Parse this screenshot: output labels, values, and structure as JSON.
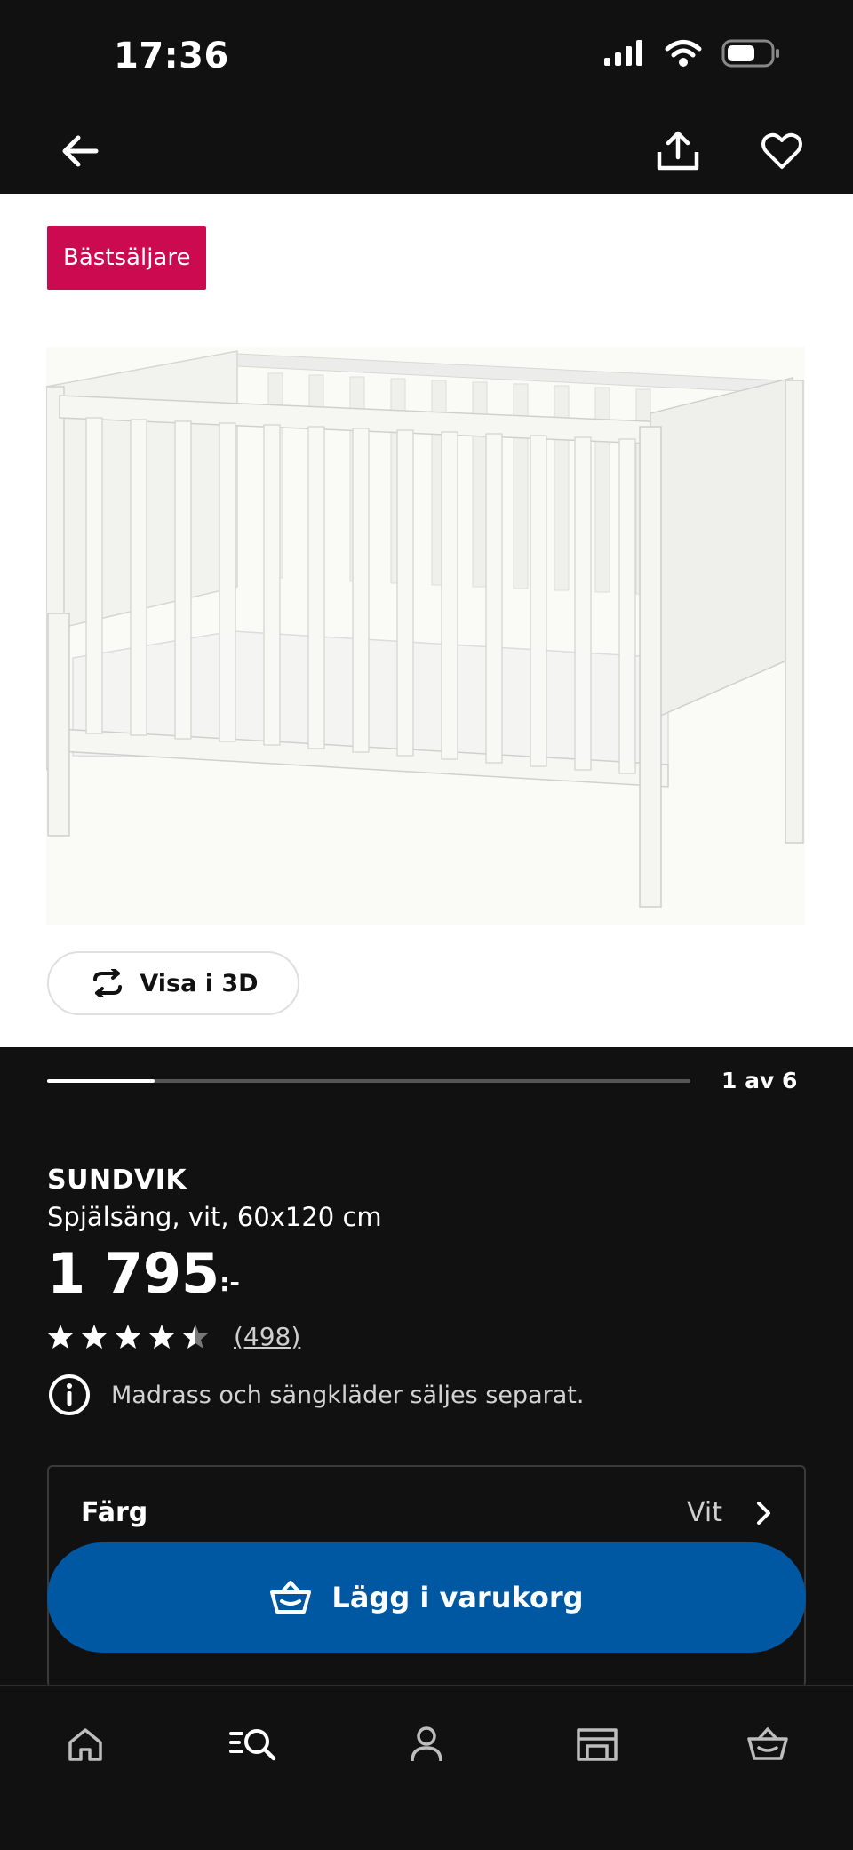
{
  "status_bar": {
    "time": "17:36"
  },
  "nav": {
    "back_icon": "arrow-left-icon",
    "share_icon": "share-icon",
    "favorite_icon": "heart-icon"
  },
  "product": {
    "badge": "Bästsäljare",
    "view_3d_label": "Visa i 3D",
    "image_position": "1 av 6",
    "image_progress_fraction": 0.1667,
    "brand": "SUNDVIK",
    "description": "Spjälsäng, vit, 60x120 cm",
    "price_main": "1 795",
    "price_suffix": ":-",
    "rating_stars": 4.5,
    "review_count": "(498)",
    "notice": "Madrass och sängkläder säljes separat."
  },
  "color": {
    "label": "Färg",
    "value": "Vit"
  },
  "cart": {
    "add_label": "Lägg i varukorg"
  },
  "tabs": [
    {
      "icon": "home-icon"
    },
    {
      "icon": "search-icon"
    },
    {
      "icon": "profile-icon"
    },
    {
      "icon": "store-icon"
    },
    {
      "icon": "basket-icon"
    }
  ],
  "colors": {
    "background": "#111111",
    "badge": "#cc0a50",
    "primary_button": "#0058a3"
  }
}
